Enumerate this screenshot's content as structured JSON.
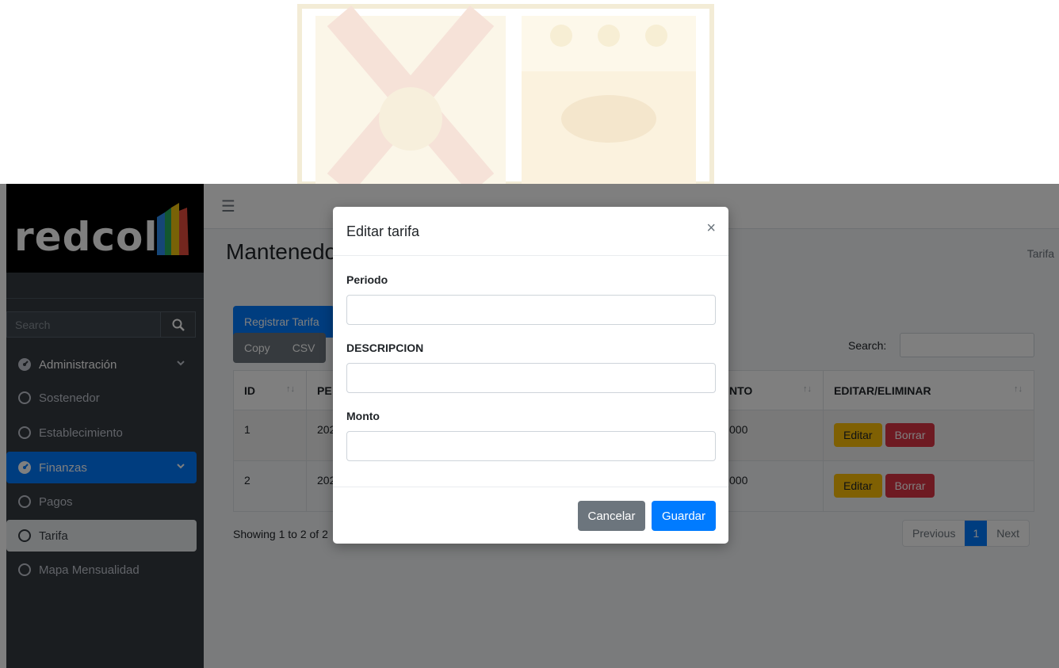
{
  "brand": {
    "name": "redcol"
  },
  "sidebar": {
    "search_placeholder": "Search",
    "items": [
      {
        "label": "Administración",
        "icon": "gauge-icon",
        "expandable": true
      },
      {
        "label": "Sostenedor",
        "icon": "circle-icon"
      },
      {
        "label": "Establecimiento",
        "icon": "circle-icon"
      },
      {
        "label": "Finanzas",
        "icon": "gauge-icon",
        "expandable": true,
        "state": "open"
      },
      {
        "label": "Pagos",
        "icon": "circle-icon"
      },
      {
        "label": "Tarifa",
        "icon": "circle-icon",
        "state": "active"
      },
      {
        "label": "Mapa Mensualidad",
        "icon": "circle-icon"
      }
    ]
  },
  "header": {
    "menu_icon": "hamburger-icon",
    "title": "Mantenedo",
    "breadcrumb": "Tarifa"
  },
  "toolbar": {
    "register_label": "Registrar Tarifa",
    "copy_label": "Copy",
    "csv_label": "CSV",
    "search_label": "Search:"
  },
  "table": {
    "headers": [
      "ID",
      "PE",
      "NTO",
      "EDITAR/ELIMINAR"
    ],
    "rows": [
      {
        "id": "1",
        "periodo": "202",
        "monto": "000"
      },
      {
        "id": "2",
        "periodo": "202",
        "monto": "000"
      }
    ],
    "edit_label": "Editar",
    "delete_label": "Borrar",
    "footer_text": "Showing 1 to 2 of 2",
    "pager": {
      "prev": "Previous",
      "current": "1",
      "next": "Next"
    }
  },
  "modal": {
    "title": "Editar tarifa",
    "close": "×",
    "fields": [
      {
        "label": "Periodo",
        "value": ""
      },
      {
        "label": "DESCRIPCION",
        "value": ""
      },
      {
        "label": "Monto",
        "value": ""
      }
    ],
    "cancel_label": "Cancelar",
    "save_label": "Guardar"
  },
  "colors": {
    "primary": "#007bff",
    "secondary": "#6c757d",
    "warning": "#ffc107",
    "danger": "#dc3545",
    "sidebar": "#343a40"
  }
}
